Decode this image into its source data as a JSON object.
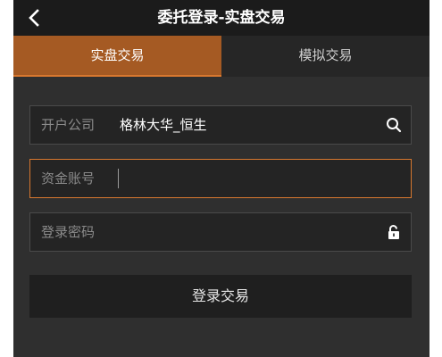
{
  "header": {
    "title": "委托登录-实盘交易",
    "back_icon": "chevron-left-icon"
  },
  "tabs": [
    {
      "label": "实盘交易",
      "active": true
    },
    {
      "label": "模拟交易",
      "active": false
    }
  ],
  "form": {
    "company": {
      "label": "开户公司",
      "value": "格林大华_恒生",
      "icon": "search-icon"
    },
    "account": {
      "label": "资金账号",
      "value": "",
      "focused": true
    },
    "password": {
      "label": "登录密码",
      "value": "",
      "icon": "unlock-icon"
    },
    "submit_label": "登录交易"
  },
  "colors": {
    "accent": "#d8782f",
    "active_tab": "#a55a23",
    "background": "#2f2f2f"
  }
}
